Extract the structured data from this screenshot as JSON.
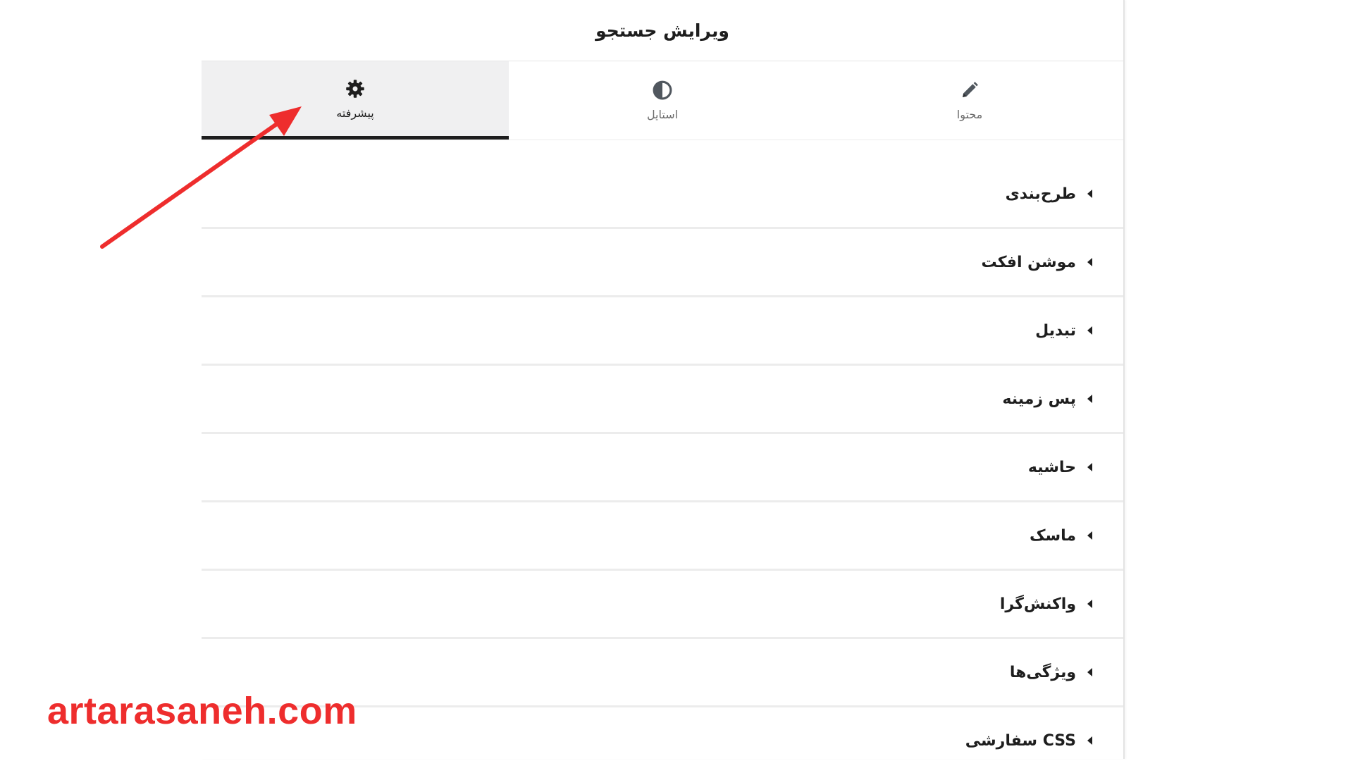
{
  "panel": {
    "title": "ویرایش جستجو"
  },
  "tabs": [
    {
      "label": "محتوا",
      "icon": "pencil-icon",
      "active": false
    },
    {
      "label": "استایل",
      "icon": "contrast-icon",
      "active": false
    },
    {
      "label": "پیشرفته",
      "icon": "gear-icon",
      "active": true
    }
  ],
  "sections": [
    {
      "label": "طرح‌بندی"
    },
    {
      "label": "موشن افکت"
    },
    {
      "label": "تبدیل"
    },
    {
      "label": "پس زمینه"
    },
    {
      "label": "حاشیه"
    },
    {
      "label": "ماسک"
    },
    {
      "label": "واکنش‌گرا"
    },
    {
      "label": "ویژگی‌ها"
    },
    {
      "label": "CSS سفارشی"
    }
  ],
  "watermark": "artarasaneh.com",
  "colors": {
    "annotation_arrow": "#ee2d2d",
    "active_tab_bg": "#f0f0f1",
    "active_tab_underline": "#1e1e1e",
    "text": "#1e1e1e"
  }
}
